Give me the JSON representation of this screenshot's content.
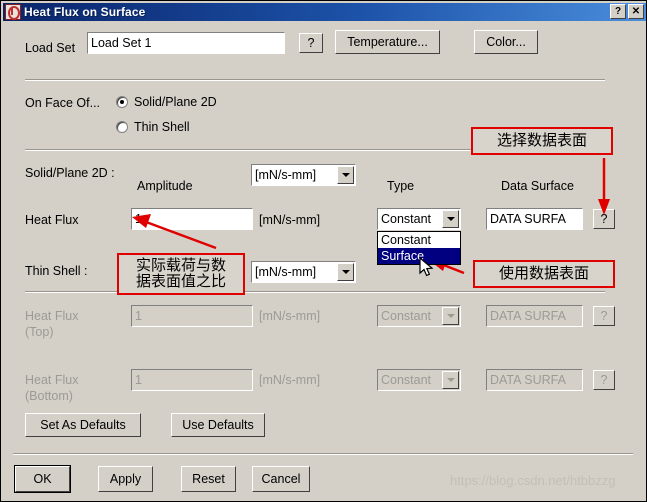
{
  "window": {
    "title": "Heat Flux on Surface",
    "icon": "app-icon",
    "help_button": "?",
    "close_button": "✕"
  },
  "load_set": {
    "label": "Load Set",
    "value": "Load Set 1",
    "placeholder": "Load Set 1",
    "help_button": "?",
    "temperature_button": "Temperature...",
    "color_button": "Color..."
  },
  "on_face_of": {
    "label": "On Face Of...",
    "options": [
      {
        "label": "Solid/Plane 2D",
        "selected": true
      },
      {
        "label": "Thin Shell",
        "selected": false
      }
    ]
  },
  "solid_section": {
    "title": "Solid/Plane 2D :",
    "amplitude_header": "Amplitude",
    "units_header_value": "[mN/s-mm]",
    "type_header": "Type",
    "data_surface_header": "Data Surface",
    "row": {
      "label": "Heat Flux",
      "amplitude_value": "1",
      "units_text": "[mN/s-mm]",
      "type_value": "Constant",
      "data_surface_value": "DATA SURFA",
      "help_button": "?"
    },
    "type_dropdown": {
      "open": true,
      "options": [
        {
          "label": "Constant",
          "selected": false
        },
        {
          "label": "Surface",
          "selected": true
        }
      ]
    }
  },
  "thin_shell_section": {
    "title": "Thin Shell :",
    "units_header_value": "[mN/s-mm]",
    "rows": [
      {
        "label_line1": "Heat Flux",
        "label_line2": "(Top)",
        "amplitude_value": "1",
        "units_text": "[mN/s-mm]",
        "type_value": "Constant",
        "data_surface_value": "DATA SURFA",
        "help_button": "?",
        "disabled": true
      },
      {
        "label_line1": "Heat Flux",
        "label_line2": "(Bottom)",
        "amplitude_value": "1",
        "units_text": "[mN/s-mm]",
        "type_value": "Constant",
        "data_surface_value": "DATA SURFA",
        "help_button": "?",
        "disabled": true
      }
    ]
  },
  "defaults_buttons": {
    "set_as_defaults": "Set As Defaults",
    "use_defaults": "Use Defaults"
  },
  "dialog_buttons": {
    "ok": "OK",
    "apply": "Apply",
    "reset": "Reset",
    "cancel": "Cancel"
  },
  "annotations": [
    {
      "id": "select-data-surface",
      "text": "选择数据表面"
    },
    {
      "id": "load-to-data-ratio",
      "line1": "实际载荷与数",
      "line2": "据表面值之比"
    },
    {
      "id": "use-data-surface",
      "text": "使用数据表面"
    }
  ],
  "watermark": {
    "text": "https://blog.csdn.net/htbbzzg"
  },
  "colors": {
    "dialog_face": "#d4d0c8",
    "title_left": "#0a246a",
    "title_right": "#4a8ddc",
    "annotation_red": "#e00000",
    "selection_blue": "#000080"
  }
}
